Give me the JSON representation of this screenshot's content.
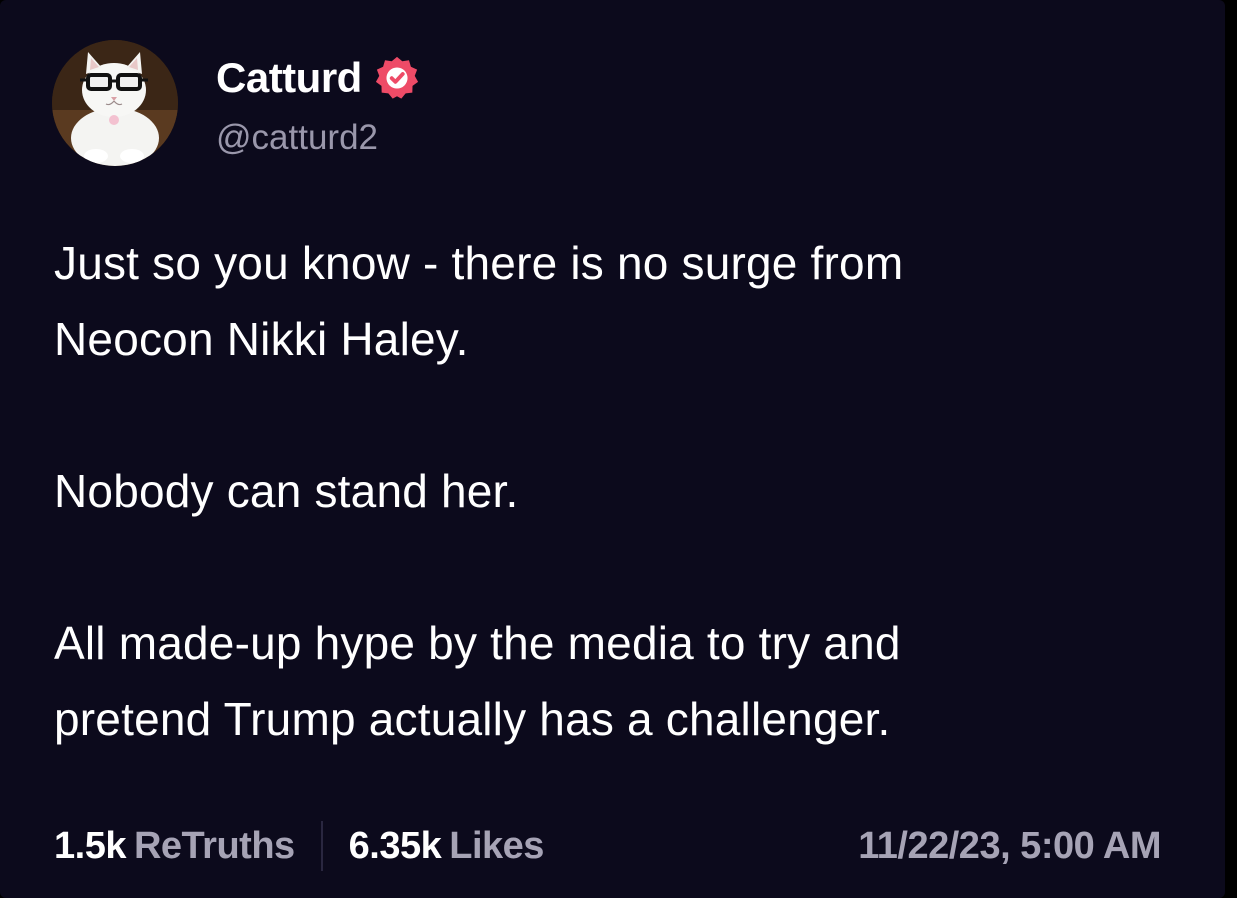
{
  "author": {
    "display_name": "Catturd",
    "handle": "@catturd2",
    "verified": true,
    "verified_color": "#ee4b67"
  },
  "post": {
    "paragraphs": [
      "Just so you know - there is no surge from\nNeocon Nikki Haley.",
      "Nobody can stand her.",
      "All made-up hype by the media to try and\npretend Trump actually has a challenger."
    ]
  },
  "stats": {
    "retruths_count": "1.5k",
    "retruths_label": "ReTruths",
    "likes_count": "6.35k",
    "likes_label": "Likes"
  },
  "timestamp": "11/22/23, 5:00 AM",
  "colors": {
    "background": "#0c0a1c",
    "text": "#ffffff",
    "muted": "#a6a3b5"
  }
}
